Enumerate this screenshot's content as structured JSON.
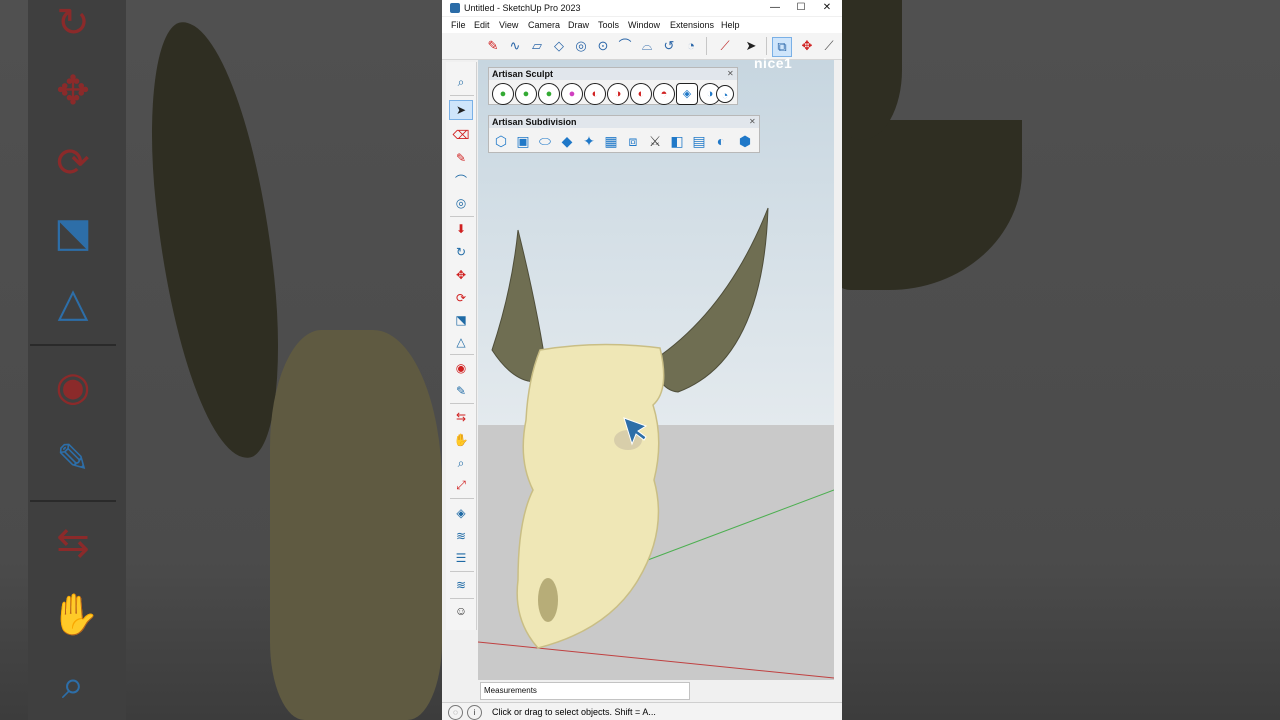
{
  "window": {
    "title": "Untitled - SketchUp Pro 2023",
    "controls": {
      "minimize": "—",
      "maximize": "☐",
      "close": "✕"
    }
  },
  "menu": [
    "File",
    "Edit",
    "View",
    "Camera",
    "Draw",
    "Tools",
    "Window",
    "Extensions",
    "Help"
  ],
  "panels": {
    "sculpt": {
      "title": "Artisan Sculpt",
      "close": "✕"
    },
    "subdivision": {
      "title": "Artisan Subdivision",
      "close": "✕"
    }
  },
  "watermark": "nice1",
  "measurements_label": "Measurements",
  "status_text": "Click or drag to select objects. Shift = A...",
  "colors": {
    "horn": "#6f6e52",
    "skull": "#efe7b6",
    "sky": "#c7d6e0",
    "ground": "#c9c9c9",
    "axis_red": "#c04040",
    "axis_green": "#4caf50"
  }
}
